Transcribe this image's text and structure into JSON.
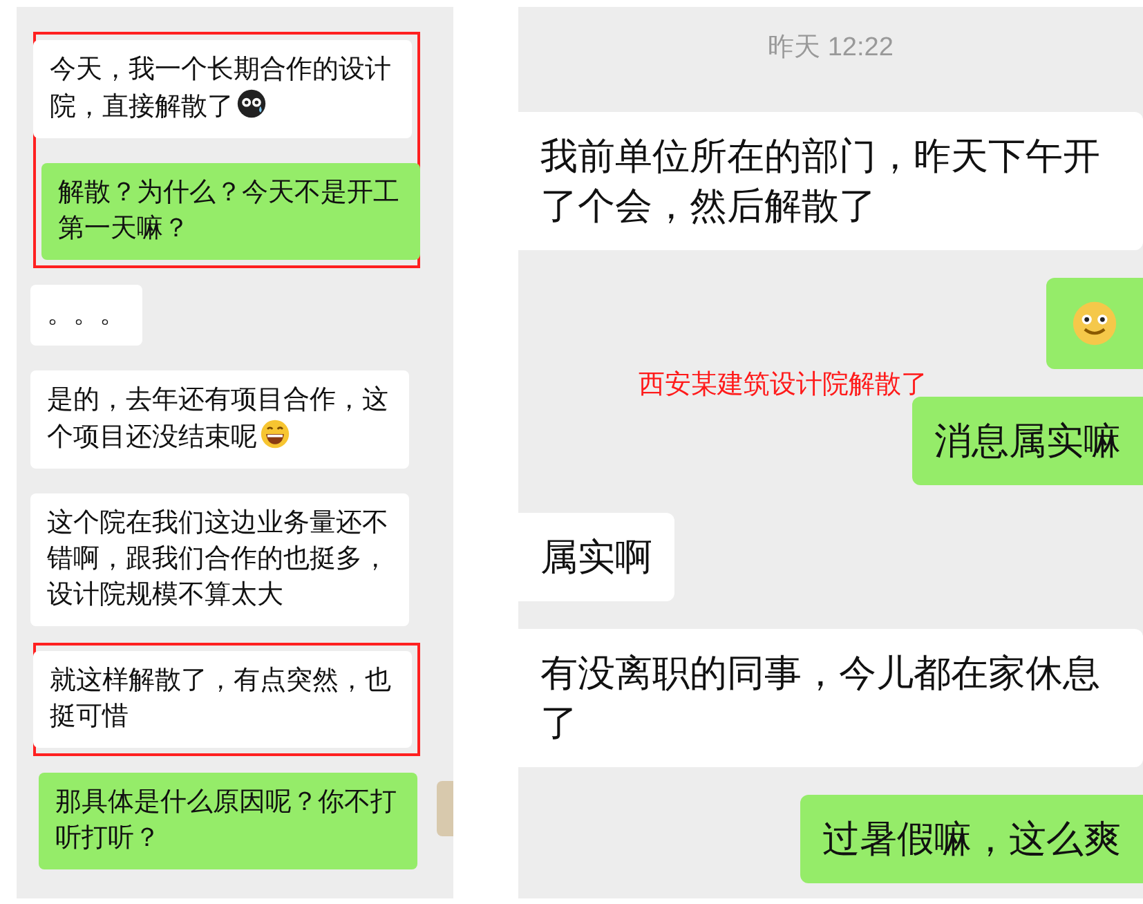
{
  "left_chat": {
    "messages": [
      {
        "kind": "incoming",
        "text": "今天，我一个长期合作的设计院，直接解散了",
        "emoji": {
          "kind": "sweat"
        },
        "boxed": true
      },
      {
        "kind": "outgoing",
        "text": "解散？为什么？今天不是开工第一天嘛？",
        "boxed": true
      },
      {
        "kind": "incoming",
        "text": "。。。",
        "boxed": false
      },
      {
        "kind": "incoming",
        "text": "是的，去年还有项目合作，这个项目还没结束呢",
        "emoji": {
          "kind": "grin"
        },
        "boxed": false
      },
      {
        "kind": "incoming",
        "text": "这个院在我们这边业务量还不错啊，跟我们合作的也挺多，设计院规模不算太大",
        "boxed": false
      },
      {
        "kind": "incoming",
        "text": "就这样解散了，有点突然，也挺可惜",
        "boxed": true
      },
      {
        "kind": "outgoing",
        "text": "那具体是什么原因呢？你不打听打听？",
        "boxed": false
      }
    ]
  },
  "right_chat": {
    "timestamp": "昨天 12:22",
    "messages": [
      {
        "kind": "incoming",
        "text": "我前单位所在的部门，昨天下午开了个会，然后解散了"
      },
      {
        "kind": "outgoing",
        "emoji": {
          "kind": "smile"
        }
      },
      {
        "kind": "outgoing",
        "text": "消息属实嘛"
      },
      {
        "kind": "incoming",
        "text": "属实啊"
      },
      {
        "kind": "incoming",
        "text": "有没离职的同事，今儿都在家休息了"
      },
      {
        "kind": "outgoing",
        "text": "过暑假嘛，这么爽"
      }
    ]
  },
  "caption": "西安某建筑设计院解散了"
}
